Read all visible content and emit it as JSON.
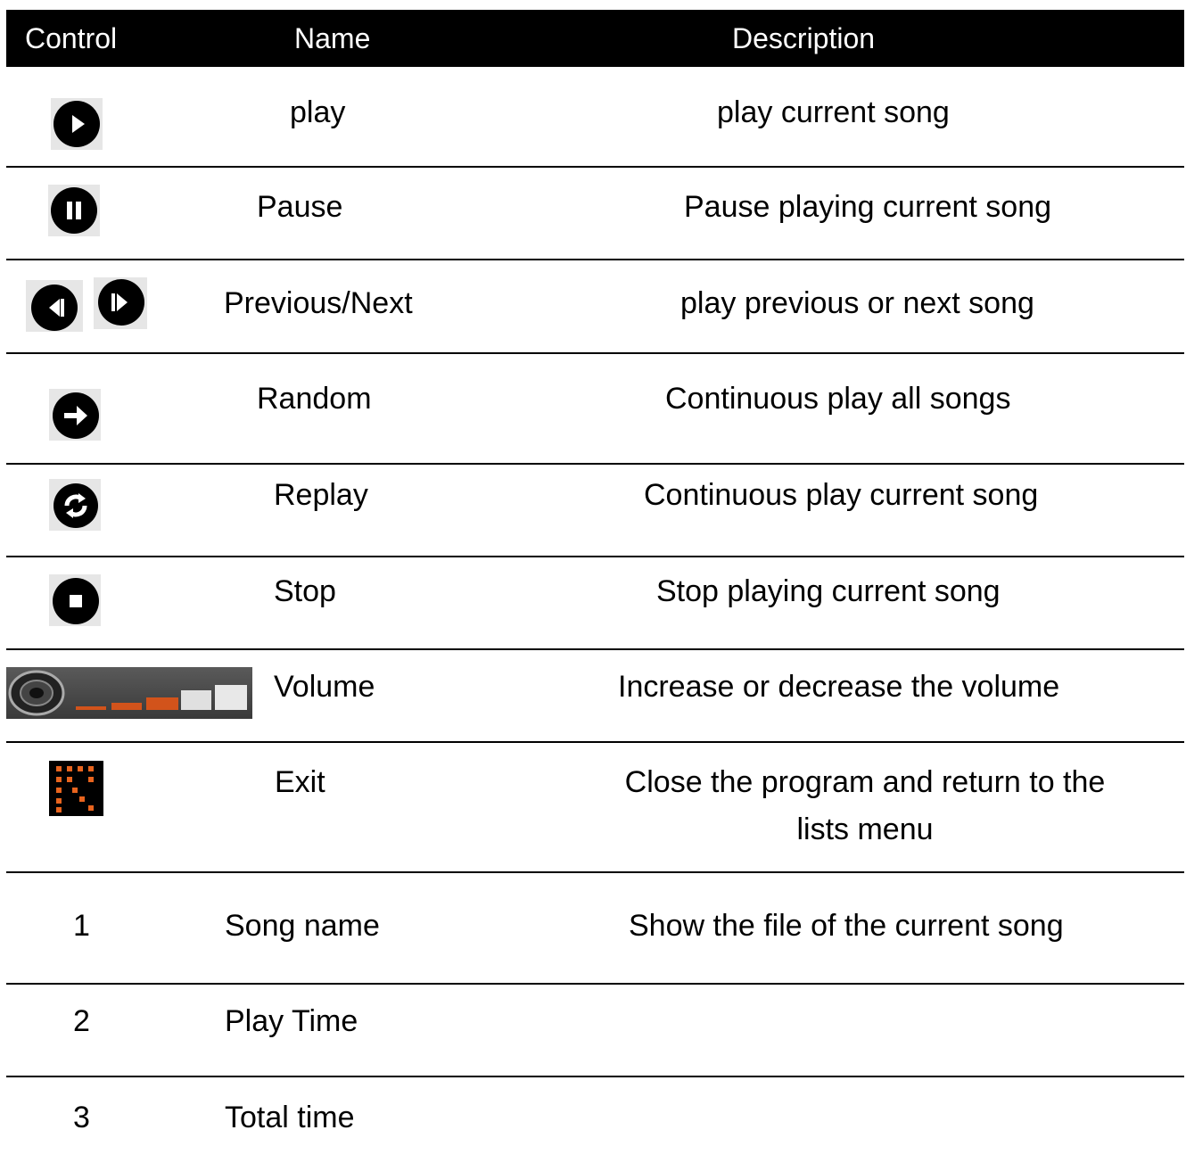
{
  "header": {
    "control": "Control",
    "name": "Name",
    "description": "Description"
  },
  "rows": [
    {
      "control": "",
      "icon": "play-icon",
      "name": "play",
      "description": "play current song"
    },
    {
      "control": "",
      "icon": "pause-icon",
      "name": "Pause",
      "description": "Pause playing current song"
    },
    {
      "control": "",
      "icon": "previous-next-icons",
      "name": "Previous/Next",
      "description": "play previous or next song"
    },
    {
      "control": "",
      "icon": "random-icon",
      "name": "Random",
      "description": "Continuous play all songs"
    },
    {
      "control": "",
      "icon": "replay-icon",
      "name": "Replay",
      "description": "Continuous play current song"
    },
    {
      "control": "",
      "icon": "stop-icon",
      "name": "Stop",
      "description": "Stop playing current song"
    },
    {
      "control": "",
      "icon": "volume-icon",
      "name": "Volume",
      "description": "Increase or decrease the volume"
    },
    {
      "control": "",
      "icon": "exit-icon",
      "name": "Exit",
      "description": "Close the program and return to the lists menu"
    },
    {
      "control": "1",
      "icon": "",
      "name": "Song name",
      "description": "Show the file of the current song"
    },
    {
      "control": "2",
      "icon": "",
      "name": "Play Time",
      "description": ""
    },
    {
      "control": "3",
      "icon": "",
      "name": "Total time",
      "description": ""
    }
  ],
  "colors": {
    "header_bg": "#000000",
    "header_text": "#ffffff",
    "icon_bg": "#e6e6e6",
    "volume_orange": "#d2531b",
    "exit_orange": "#e8641e"
  }
}
